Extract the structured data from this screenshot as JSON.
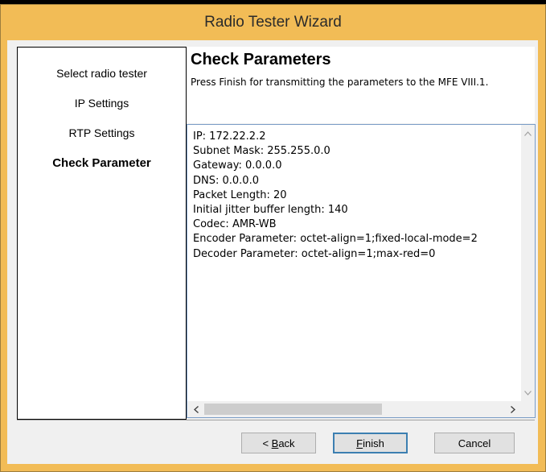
{
  "window": {
    "title": "Radio Tester Wizard"
  },
  "steps": [
    {
      "label": "Select radio tester",
      "active": false
    },
    {
      "label": "IP Settings",
      "active": false
    },
    {
      "label": "RTP Settings",
      "active": false
    },
    {
      "label": "Check Parameter",
      "active": true
    }
  ],
  "header": {
    "title": "Check Parameters",
    "description": "Press Finish for transmitting the parameters to the MFE VIII.1."
  },
  "parameters": [
    "IP: 172.22.2.2",
    "Subnet Mask: 255.255.0.0",
    "Gateway: 0.0.0.0",
    "DNS: 0.0.0.0",
    "Packet Length: 20",
    "Initial jitter buffer length: 140",
    "Codec: AMR-WB",
    "Encoder Parameter: octet-align=1;fixed-local-mode=2",
    "Decoder Parameter: octet-align=1;max-red=0"
  ],
  "buttons": {
    "back": {
      "prefix": "< ",
      "mnemonic": "B",
      "rest": "ack"
    },
    "finish": {
      "prefix": "",
      "mnemonic": "F",
      "rest": "inish"
    },
    "cancel": {
      "label": "Cancel"
    }
  },
  "icons": {
    "scroll_up": "chevron-up-icon",
    "scroll_down": "chevron-down-icon",
    "scroll_left": "chevron-left-icon",
    "scroll_right": "chevron-right-icon"
  },
  "colors": {
    "title_bar": "#f2bc56",
    "text_box_border": "#7a9cc6",
    "default_button_border": "#3c7fb1"
  }
}
